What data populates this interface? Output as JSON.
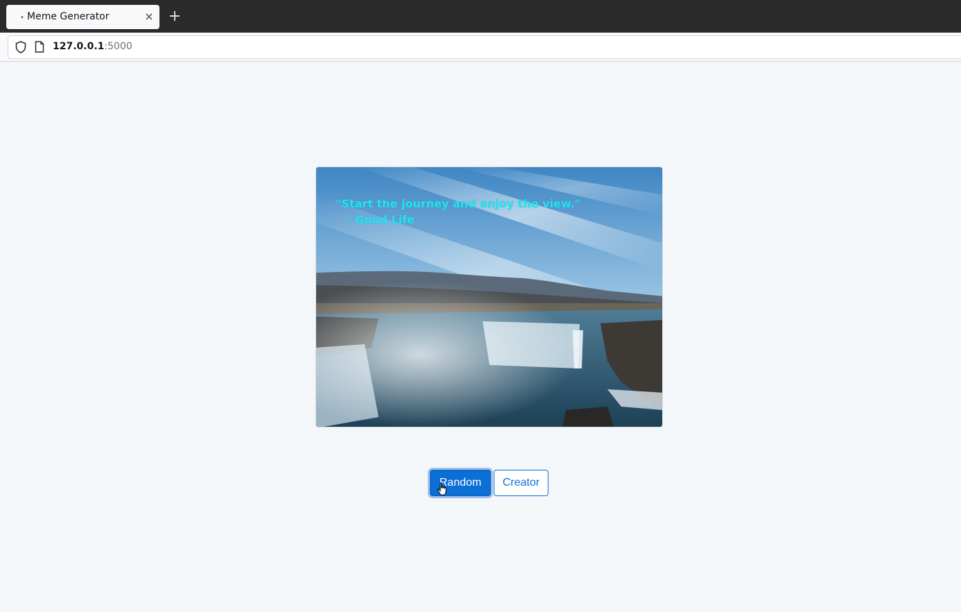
{
  "browser": {
    "tab_title": "Meme Generator",
    "tab_dot": "•",
    "tab_close": "×",
    "new_tab": "+",
    "url_host": "127.0.0.1",
    "url_port": ":5000"
  },
  "meme": {
    "quote": "\"Start the journey and enjoy the view.\"",
    "author": "- Good Life"
  },
  "actions": {
    "random_label": "Random",
    "creator_label": "Creator"
  },
  "colors": {
    "primary": "#0b6fd6",
    "quote_text": "#1ee6f0",
    "page_bg": "#f4f7f9"
  }
}
